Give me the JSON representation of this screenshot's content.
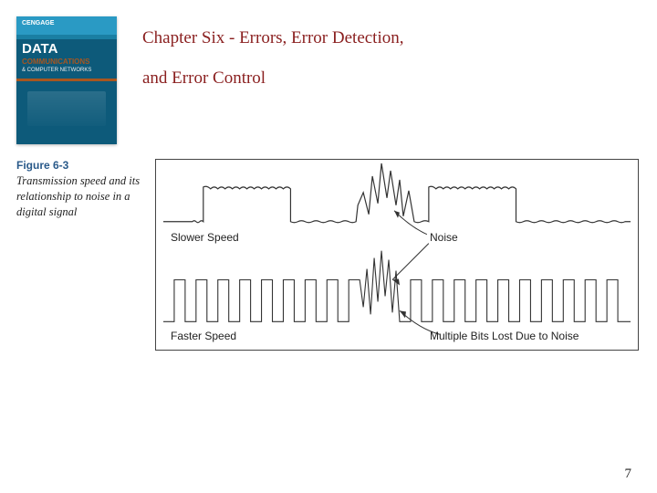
{
  "header": {
    "book": {
      "brand": "CENGAGE",
      "title": "DATA",
      "subtitle1": "COMMUNICATIONS",
      "subtitle2": "& COMPUTER NETWORKS"
    },
    "chapter_title_line1": "Chapter Six - Errors, Error Detection,",
    "chapter_title_line2": "and Error Control"
  },
  "figure": {
    "label": "Figure 6-3",
    "caption": "Transmission speed and its relationship to noise in a digital signal",
    "labels": {
      "slower_speed": "Slower Speed",
      "noise": "Noise",
      "faster_speed": "Faster Speed",
      "multiple_bits": "Multiple Bits Lost Due to Noise"
    }
  },
  "page_number": "7"
}
